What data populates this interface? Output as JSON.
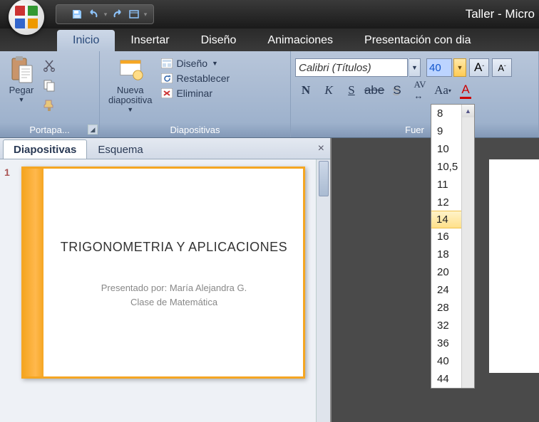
{
  "title": "Taller - Micro",
  "tabs": {
    "inicio": "Inicio",
    "insertar": "Insertar",
    "diseno": "Diseño",
    "animaciones": "Animaciones",
    "presentacion": "Presentación con dia"
  },
  "ribbon": {
    "portapapeles": {
      "label": "Portapa...",
      "pegar": "Pegar"
    },
    "diapositivas": {
      "label": "Diapositivas",
      "nueva": "Nueva\ndiapositiva",
      "diseno": "Diseño",
      "restablecer": "Restablecer",
      "eliminar": "Eliminar"
    },
    "fuente": {
      "label": "Fuer",
      "fontname": "Calibri (Títulos)",
      "fontsize": "40",
      "sizes": [
        "8",
        "9",
        "10",
        "10,5",
        "11",
        "12",
        "14",
        "16",
        "18",
        "20",
        "24",
        "28",
        "32",
        "36",
        "40",
        "44"
      ],
      "highlighted": "14"
    }
  },
  "sidepanel": {
    "tab_diapositivas": "Diapositivas",
    "tab_esquema": "Esquema",
    "slidenum": "1",
    "slide_title": "TRIGONOMETRIA Y APLICACIONES",
    "slide_sub1": "Presentado por: María Alejandra G.",
    "slide_sub2": "Clase de Matemática"
  }
}
